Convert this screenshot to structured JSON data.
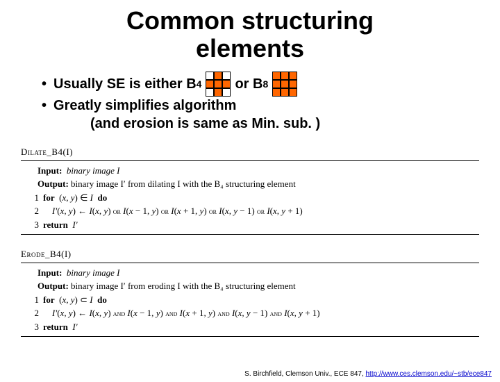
{
  "title_line1": "Common structuring",
  "title_line2": "elements",
  "bullet1_pre": "Usually SE is either B",
  "bullet1_sub1": "4",
  "bullet1_mid": "  or B",
  "bullet1_sub2": "8",
  "bullet2": "Greatly simplifies algorithm",
  "bullet2b": "(and erosion is same as Min. sub. )",
  "dilate": {
    "name": "Dilate_B4(I)",
    "input_label": "Input:",
    "input_text": "binary image  I",
    "output_label": "Output:",
    "output_text": "binary image  I′  from dilating  I  with the  B₄  structuring element",
    "l1": "for  (x, y) ∈ I  do",
    "l2": "I′(x, y) ← I(x, y) ᴏʀ I(x − 1, y) ᴏʀ I(x + 1, y) ᴏʀ I(x, y − 1) ᴏʀ I(x, y + 1)",
    "l3": "return  I′"
  },
  "erode": {
    "name": "Erode_B4(I)",
    "input_label": "Input:",
    "input_text": "binary image  I",
    "output_label": "Output:",
    "output_text": "binary image  I′  from eroding  I  with the  B₄  structuring element",
    "l1": "for  (x, y) ⊂ I  do",
    "l2": "I′(x, y) ← I(x, y) ᴀɴᴅ I(x − 1, y) ᴀɴᴅ I(x + 1, y) ᴀɴᴅ I(x, y − 1) ᴀɴᴅ I(x, y + 1)",
    "l3": "return  I′"
  },
  "footer_text": "S. Birchfield, Clemson Univ., ECE 847, ",
  "footer_link": "http://www.ces.clemson.edu/~stb/ece847"
}
